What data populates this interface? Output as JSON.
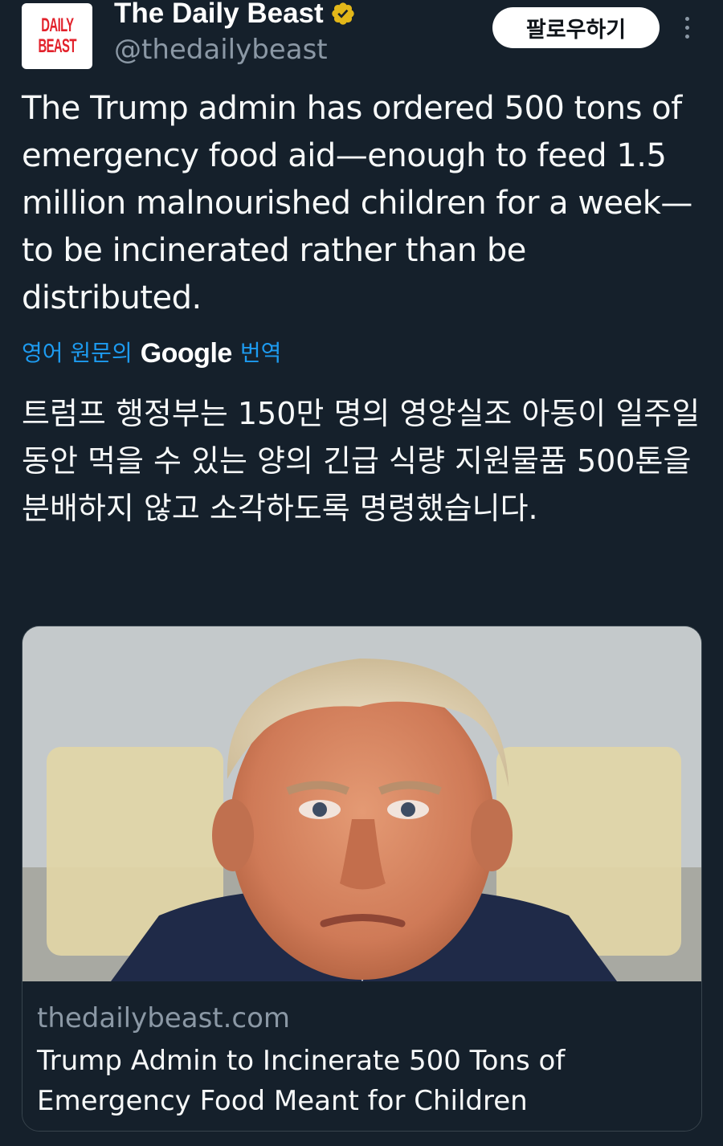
{
  "account": {
    "logo_line1": "DAILY",
    "logo_line2": "BEAST",
    "name": "The Daily Beast",
    "handle": "@thedailybeast",
    "verified_color": "#e2b719"
  },
  "actions": {
    "follow_label": "팔로우하기",
    "more_icon": "more-vertical-icon"
  },
  "tweet": {
    "text_en": "The Trump admin has ordered 500 tons of emergency food aid—enough to feed 1.5 million malnourished children for a week—to be incinerated rather than be distributed.",
    "translation": {
      "prefix": "영어 원문의",
      "provider": "Google",
      "suffix": "번역"
    },
    "text_ko": "트럼프 행정부는 150만 명의 영양실조 아동이 일주일 동안 먹을 수 있는 양의 긴급 식량 지원물품 500톤을 분배하지 않고 소각하도록 명령했습니다."
  },
  "card": {
    "domain": "thedailybeast.com",
    "title": "Trump Admin to Incinerate 500 Tons of Emergency Food Meant for Children"
  },
  "colors": {
    "background": "#15202b",
    "link": "#1d9bf0",
    "secondary_text": "#8b98a5",
    "brand_red": "#e2212b"
  }
}
